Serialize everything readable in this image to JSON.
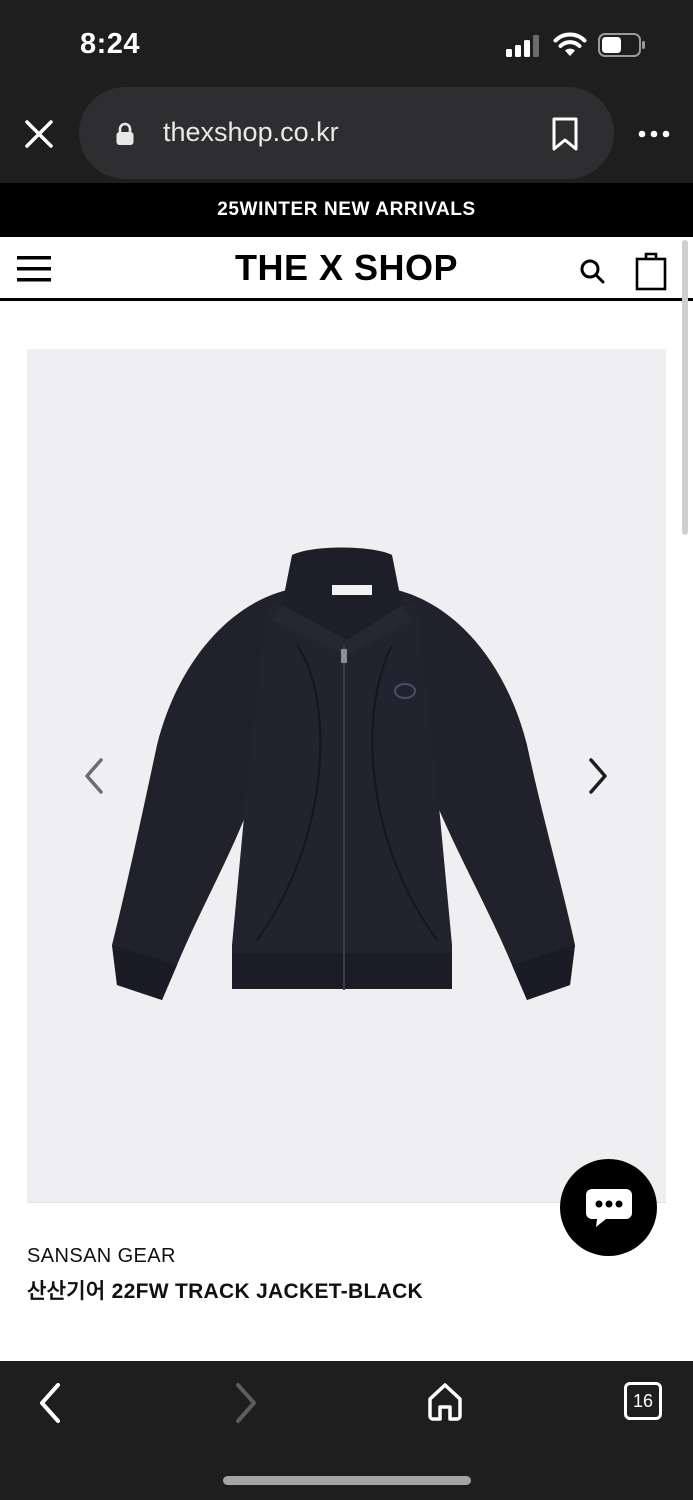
{
  "status_bar": {
    "time": "8:24"
  },
  "browser": {
    "url": "thexshop.co.kr",
    "tab_count": "16"
  },
  "promo_banner": {
    "text": "25WINTER NEW ARRIVALS"
  },
  "site_header": {
    "logo": "THE X SHOP"
  },
  "product": {
    "brand": "SANSAN GEAR",
    "name": "산산기어 22FW TRACK JACKET-BLACK"
  },
  "colors": {
    "chrome_bg": "#1e1e1f",
    "url_pill_bg": "#2e2e30",
    "promo_bg": "#000000",
    "gallery_bg": "#efeff1",
    "jacket_color": "#20212b",
    "chat_button_bg": "#000000"
  },
  "icons": {
    "close": "close-icon",
    "lock": "lock-icon",
    "bookmark": "bookmark-icon",
    "more": "more-icon",
    "menu": "hamburger-menu-icon",
    "search": "search-icon",
    "cart": "shopping-bag-icon",
    "prev": "chevron-left-icon",
    "next": "chevron-right-icon",
    "chat": "chat-bubble-icon",
    "back": "back-arrow-icon",
    "forward": "forward-arrow-icon",
    "home": "home-icon",
    "tabs": "tabs-icon"
  }
}
